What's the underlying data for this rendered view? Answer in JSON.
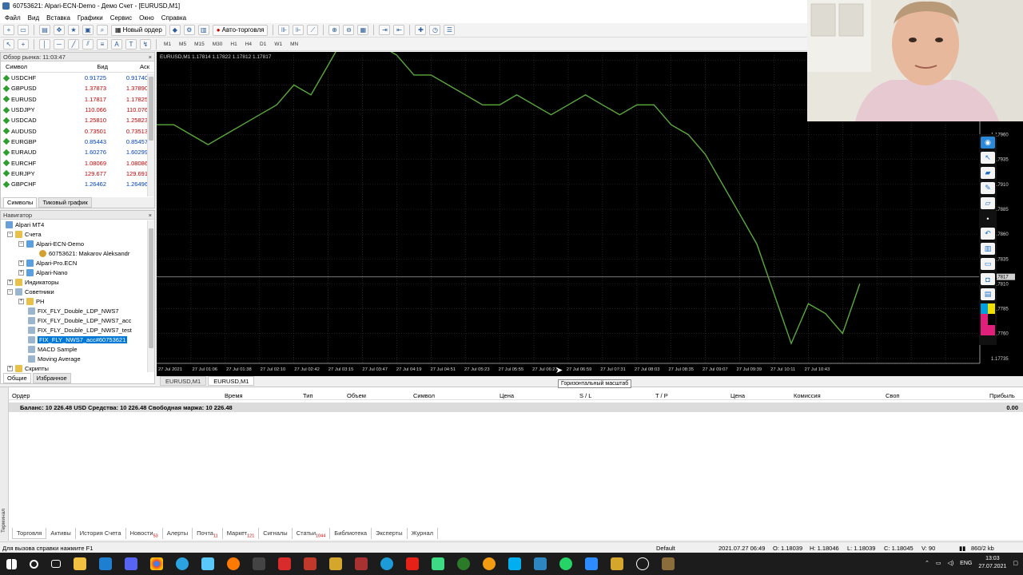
{
  "window": {
    "title": "60753621: Alpari-ECN-Demo - Демо Счет - [EURUSD,M1]"
  },
  "menu": [
    "Файл",
    "Вид",
    "Вставка",
    "Графики",
    "Сервис",
    "Окно",
    "Справка"
  ],
  "toolbar": {
    "new_order": "Новый ордер",
    "auto_trading": "Авто-торговля",
    "timeframes": [
      "M1",
      "M5",
      "M15",
      "M30",
      "H1",
      "H4",
      "D1",
      "W1",
      "MN"
    ]
  },
  "market_watch": {
    "title": "Обзор рынка: 11:03:47",
    "columns": {
      "symbol": "Символ",
      "bid": "Бид",
      "ask": "Аск"
    },
    "rows": [
      {
        "symbol": "USDCHF",
        "bid": "0.91725",
        "ask": "0.91740",
        "dir": "up"
      },
      {
        "symbol": "GBPUSD",
        "bid": "1.37873",
        "ask": "1.37890",
        "dir": "down"
      },
      {
        "symbol": "EURUSD",
        "bid": "1.17817",
        "ask": "1.17825",
        "dir": "down"
      },
      {
        "symbol": "USDJPY",
        "bid": "110.066",
        "ask": "110.076",
        "dir": "down"
      },
      {
        "symbol": "USDCAD",
        "bid": "1.25810",
        "ask": "1.25823",
        "dir": "down"
      },
      {
        "symbol": "AUDUSD",
        "bid": "0.73501",
        "ask": "0.73513",
        "dir": "down"
      },
      {
        "symbol": "EURGBP",
        "bid": "0.85443",
        "ask": "0.85457",
        "dir": "up"
      },
      {
        "symbol": "EURAUD",
        "bid": "1.60276",
        "ask": "1.60299",
        "dir": "up"
      },
      {
        "symbol": "EURCHF",
        "bid": "1.08069",
        "ask": "1.08086",
        "dir": "down"
      },
      {
        "symbol": "EURJPY",
        "bid": "129.677",
        "ask": "129.691",
        "dir": "down"
      },
      {
        "symbol": "GBPCHF",
        "bid": "1.26462",
        "ask": "1.26496",
        "dir": "up"
      }
    ],
    "tabs": [
      "Символы",
      "Тиковый график"
    ]
  },
  "navigator": {
    "title": "Навигатор",
    "root": "Alpari MT4",
    "accounts_label": "Счета",
    "server1": "Alpari-ECN-Demo",
    "account": "60753621: Makarov Aleksandr",
    "server2": "Alpari-Pro.ECN",
    "server3": "Alpari-Nano",
    "indicators": "Индикаторы",
    "advisors": "Советники",
    "ea_items": [
      "PH",
      "FIX_FLY_Double_LDP_NWS7",
      "FIX_FLY_Double_LDP_NWS7_acc",
      "FIX_FLY_Double_LDP_NWS7_test",
      "FIX_FLY_NWS7_acc#60753621",
      "MACD Sample",
      "Moving Average"
    ],
    "scripts": "Скрипты",
    "tabs": [
      "Общие",
      "Избранное"
    ]
  },
  "chart": {
    "header": "EURUSD,M1 1.17814 1.17822 1.17812 1.17817",
    "tabs": [
      "EURUSD,M1",
      "EURUSD,M1"
    ],
    "tooltip": "Горизонтальный масштаб",
    "current_price": "1.17817",
    "line_color": "#5aaa3c",
    "grid_color": "#3a3a3a"
  },
  "chart_data": {
    "type": "line",
    "x_labels": [
      "27 Jul 2021",
      "27 Jul 01:06",
      "27 Jul 01:38",
      "27 Jul 02:10",
      "27 Jul 02:42",
      "27 Jul 03:15",
      "27 Jul 03:47",
      "27 Jul 04:19",
      "27 Jul 04:51",
      "27 Jul 05:23",
      "27 Jul 05:55",
      "27 Jul 06:27",
      "27 Jul 06:59",
      "27 Jul 07:31",
      "27 Jul 08:03",
      "27 Jul 08:35",
      "27 Jul 09:07",
      "27 Jul 09:39",
      "27 Jul 10:11",
      "27 Jul 10:43"
    ],
    "y_ticks": [
      "1.18035",
      "1.18010",
      "1.17985",
      "1.17960",
      "1.17935",
      "1.17910",
      "1.17885",
      "1.17860",
      "1.17835",
      "1.17810",
      "1.17785",
      "1.17760",
      "1.17735"
    ],
    "ylim": [
      1.1773,
      1.1804
    ],
    "points": [
      [
        0,
        1.1797
      ],
      [
        0.5,
        1.1797
      ],
      [
        1,
        1.1796
      ],
      [
        1.5,
        1.1795
      ],
      [
        2,
        1.1796
      ],
      [
        2.5,
        1.1797
      ],
      [
        3,
        1.1798
      ],
      [
        3.5,
        1.1799
      ],
      [
        4,
        1.1801
      ],
      [
        4.5,
        1.18
      ],
      [
        5,
        1.1803
      ],
      [
        5.5,
        1.1806
      ],
      [
        6,
        1.1806
      ],
      [
        6.5,
        1.1805
      ],
      [
        7,
        1.1804
      ],
      [
        7.5,
        1.1802
      ],
      [
        8,
        1.1802
      ],
      [
        8.5,
        1.1801
      ],
      [
        9,
        1.18
      ],
      [
        9.5,
        1.1799
      ],
      [
        10,
        1.1799
      ],
      [
        10.5,
        1.18
      ],
      [
        11,
        1.1799
      ],
      [
        11.5,
        1.1798
      ],
      [
        12,
        1.1799
      ],
      [
        12.5,
        1.18
      ],
      [
        13,
        1.1799
      ],
      [
        13.5,
        1.1798
      ],
      [
        14,
        1.1799
      ],
      [
        14.5,
        1.1799
      ],
      [
        15,
        1.1797
      ],
      [
        15.5,
        1.1796
      ],
      [
        16,
        1.1794
      ],
      [
        16.5,
        1.1791
      ],
      [
        17,
        1.1788
      ],
      [
        17.5,
        1.1785
      ],
      [
        18,
        1.178
      ],
      [
        18.5,
        1.1775
      ],
      [
        19,
        1.1779
      ],
      [
        19.5,
        1.1778
      ],
      [
        20,
        1.1776
      ],
      [
        20.5,
        1.1781
      ]
    ]
  },
  "terminal": {
    "side_label": "Терминал",
    "columns": [
      "Ордер",
      "Время",
      "Тип",
      "Объем",
      "Символ",
      "Цена",
      "S / L",
      "T / P",
      "Цена",
      "Комиссия",
      "Своп",
      "Прибыль"
    ],
    "balance": "Баланс: 10 226.48 USD  Средства: 10 226.48  Свободная маржа: 10 226.48",
    "profit": "0.00",
    "tabs": [
      {
        "label": "Торговля",
        "badge": ""
      },
      {
        "label": "Активы",
        "badge": ""
      },
      {
        "label": "История Счета",
        "badge": ""
      },
      {
        "label": "Новости",
        "badge": "53"
      },
      {
        "label": "Алерты",
        "badge": ""
      },
      {
        "label": "Почта",
        "badge": "11"
      },
      {
        "label": "Маркет",
        "badge": "121"
      },
      {
        "label": "Сигналы",
        "badge": ""
      },
      {
        "label": "Статьи",
        "badge": "1044"
      },
      {
        "label": "Библиотека",
        "badge": ""
      },
      {
        "label": "Эксперты",
        "badge": ""
      },
      {
        "label": "Журнал",
        "badge": ""
      }
    ]
  },
  "status": {
    "help": "Для вызова справки нажмите F1",
    "profile": "Default",
    "datetime": "2021.07.27 06:49",
    "open": "O: 1.18039",
    "high": "H: 1.18046",
    "low": "L: 1.18039",
    "close": "C: 1.18045",
    "volume": "V: 90",
    "traffic": "860/2 kb"
  },
  "taskbar": {
    "lang": "ENG",
    "time": "13:03",
    "date": "27.07.2021"
  }
}
